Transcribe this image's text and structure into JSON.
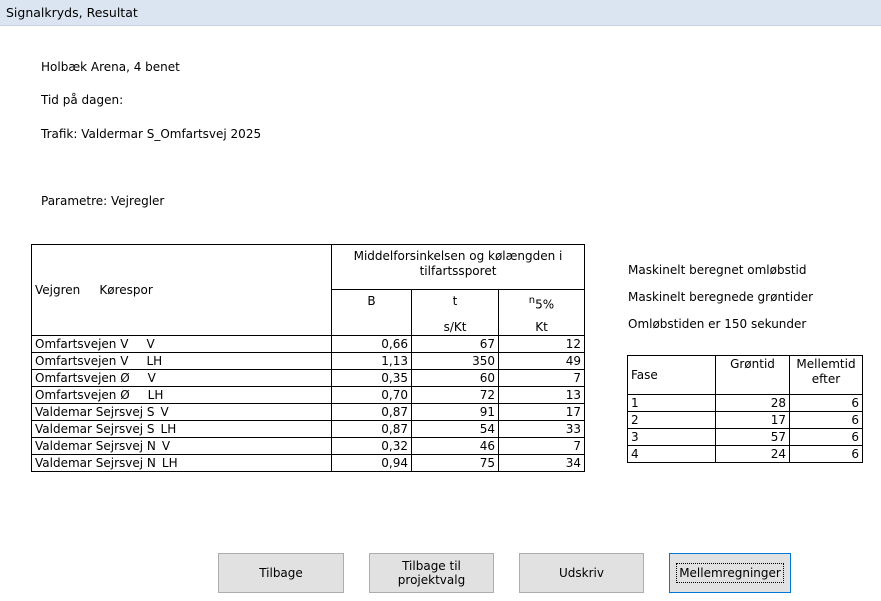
{
  "window": {
    "title": "Signalkryds, Resultat"
  },
  "info": {
    "location": "Holbæk Arena, 4 benet",
    "time_of_day": "Tid på dagen:",
    "traffic": "Trafik: Valdermar S_Omfartsvej 2025",
    "parameters": "Parametre: Vejregler"
  },
  "table": {
    "header_group": "Middelforsinkelsen og kølængden i tilfartssporet",
    "col_vejgren": "Vejgren",
    "col_korespor": "Kørespor",
    "col_b": "B",
    "col_t": "t",
    "col_n": "n",
    "col_n_sub": "5%",
    "unit_t": "s/Kt",
    "unit_n": "Kt",
    "rows": [
      {
        "vejgren": "Omfartsvejen V",
        "spor": "V",
        "b": "0,66",
        "t": "67",
        "n": "12"
      },
      {
        "vejgren": "Omfartsvejen V",
        "spor": "LH",
        "b": "1,13",
        "t": "350",
        "n": "49"
      },
      {
        "vejgren": "Omfartsvejen Ø",
        "spor": "V",
        "b": "0,35",
        "t": "60",
        "n": "7"
      },
      {
        "vejgren": "Omfartsvejen Ø",
        "spor": "LH",
        "b": "0,70",
        "t": "72",
        "n": "13"
      },
      {
        "vejgren": "Valdemar Sejrsvej S",
        "spor": "V",
        "b": "0,87",
        "t": "91",
        "n": "17"
      },
      {
        "vejgren": "Valdemar Sejrsvej S",
        "spor": "LH",
        "b": "0,87",
        "t": "54",
        "n": "33"
      },
      {
        "vejgren": "Valdemar Sejrsvej N",
        "spor": "V",
        "b": "0,32",
        "t": "46",
        "n": "7"
      },
      {
        "vejgren": "Valdemar Sejrsvej N",
        "spor": "LH",
        "b": "0,94",
        "t": "75",
        "n": "34"
      }
    ]
  },
  "side_info": {
    "line1": "Maskinelt beregnet omløbstid",
    "line2": "Maskinelt beregnede grøntider",
    "line3": "Omløbstiden er 150 sekunder"
  },
  "fase_table": {
    "col_fase": "Fase",
    "col_gron": "Grøntid",
    "col_mellem": "Mellemtid efter",
    "rows": [
      {
        "fase": "1",
        "gron": "28",
        "mellem": "6"
      },
      {
        "fase": "2",
        "gron": "17",
        "mellem": "6"
      },
      {
        "fase": "3",
        "gron": "57",
        "mellem": "6"
      },
      {
        "fase": "4",
        "gron": "24",
        "mellem": "6"
      }
    ]
  },
  "buttons": {
    "back": "Tilbage",
    "back_project": "Tilbage til projektvalg",
    "print": "Udskriv",
    "intermediate": "Mellemregninger"
  }
}
